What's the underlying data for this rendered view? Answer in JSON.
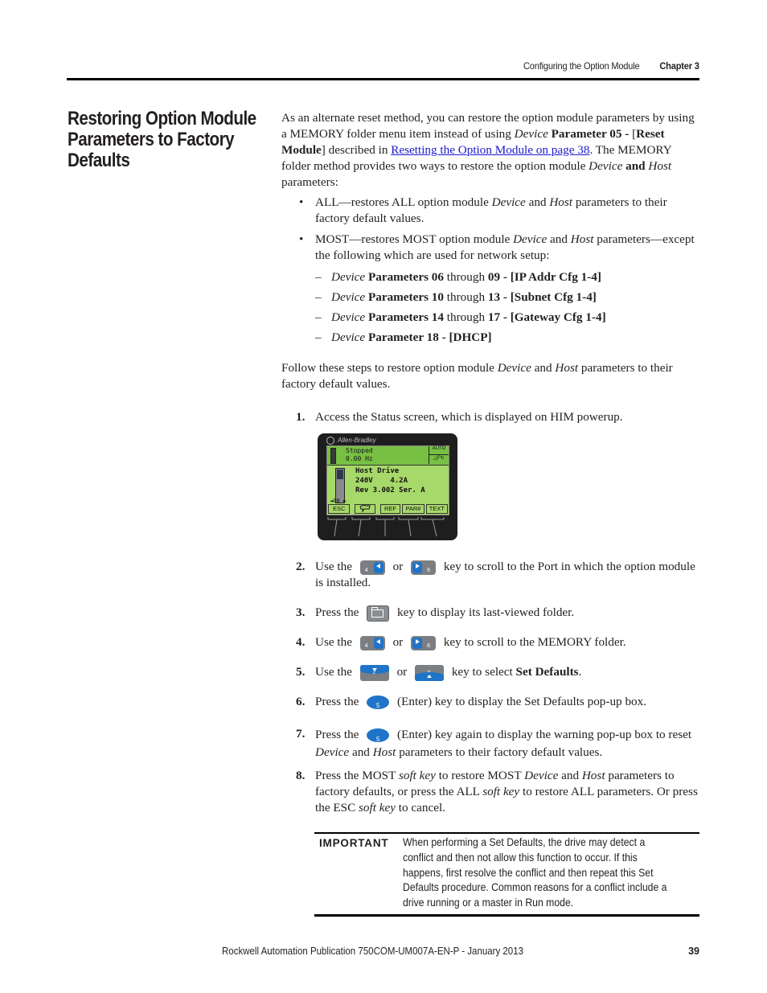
{
  "header": {
    "section": "Configuring the Option Module",
    "chapter": "Chapter 3"
  },
  "title": "Restoring Option Module Parameters to Factory Defaults",
  "intro": {
    "t1": "As an alternate reset method, you can restore the option module parameters by using a MEMORY folder menu item instead of using ",
    "device": "Device",
    "param05": "Parameter 05 -",
    "t2": "[",
    "reset_module": "Reset Module",
    "t3": "] described in ",
    "link": "Resetting the Option Module on page 38",
    "t4": ". The MEMORY folder method provides two ways to restore the option module ",
    "device2": "Device",
    "and": "and",
    "host": "Host",
    "t5": " parameters:"
  },
  "bullets": [
    {
      "pre": "ALL—restores ALL option module ",
      "device": "Device",
      "mid": " and ",
      "host": "Host",
      "post": " parameters to their factory default values."
    },
    {
      "pre": "MOST—restores MOST option module ",
      "device": "Device",
      "mid": " and ",
      "host": "Host",
      "post": " parameters—except the following which are used for network setup:"
    }
  ],
  "dash_items": [
    {
      "device": "Device",
      "b1": "Parameters 06",
      "mid": " through ",
      "b2": "09 -",
      "br": "[IP Addr Cfg 1-4]"
    },
    {
      "device": "Device",
      "b1": "Parameters 10",
      "mid": " through ",
      "b2": "13 -",
      "br": "[Subnet Cfg 1-4]"
    },
    {
      "device": "Device",
      "b1": "Parameters 14",
      "mid": " through ",
      "b2": "17 -",
      "br": "[Gateway Cfg 1-4]"
    },
    {
      "device": "Device",
      "b1": "Parameter 18 -",
      "mid": "",
      "b2": "",
      "br": "[DHCP]"
    }
  ],
  "follow": {
    "pre": "Follow these steps to restore option module ",
    "device": "Device",
    "mid": " and ",
    "host": "Host",
    "post": " parameters to their factory default values."
  },
  "steps": {
    "s1": {
      "num": "1.",
      "text": "Access the Status screen, which is displayed on HIM powerup."
    },
    "s2": {
      "num": "2.",
      "a": "Use the",
      "or": "or",
      "b": "key to scroll to the Port in which the option module is installed."
    },
    "s3": {
      "num": "3.",
      "a": "Press the",
      "b": "key to display its last-viewed folder."
    },
    "s4": {
      "num": "4.",
      "a": "Use the",
      "or": "or",
      "b": "key to scroll to the MEMORY folder."
    },
    "s5": {
      "num": "5.",
      "a": "Use the",
      "or": "or",
      "b": "key to select ",
      "bold": "Set Defaults",
      "end": "."
    },
    "s6": {
      "num": "6.",
      "a": "Press the",
      "b": "(Enter) key to display the Set Defaults pop-up box."
    },
    "s7": {
      "num": "7.",
      "a": "Press the",
      "b": "(Enter) key again to display the warning pop-up box to reset ",
      "device": "Device",
      "mid": " and ",
      "host": "Host",
      "c": " parameters to their factory default values."
    },
    "s8": {
      "num": "8.",
      "a": "Press the MOST ",
      "sk1": "soft key",
      "b": " to restore MOST ",
      "device": "Device",
      "mid": " and ",
      "host": "Host",
      "c": " parameters to factory defaults, or press the ALL ",
      "sk2": "soft key",
      "d": " to restore ALL parameters. Or press the ESC ",
      "sk3": "soft key",
      "e": " to cancel."
    }
  },
  "keys": {
    "left": "4",
    "right": "6",
    "down": "2",
    "up": "8",
    "enter": "5"
  },
  "him": {
    "brand": "Allen-Bradley",
    "status": "Stopped",
    "freq": "0.00 Hz",
    "mode": "AUTO",
    "flags": "F",
    "line1": "Host Drive",
    "line2": "240V    4.2A",
    "line3": "Rev 3.002 Ser. A",
    "port": "◄00 ►",
    "softkeys": [
      "ESC",
      "",
      "REF",
      "PAR#",
      "TEXT"
    ]
  },
  "important": {
    "label": "IMPORTANT",
    "text": "When performing a Set Defaults, the drive may detect a conflict and then not allow this function to occur. If this happens, first resolve the conflict and then repeat this Set Defaults procedure. Common reasons for a conflict include a drive running or a master in Run mode."
  },
  "footer": {
    "publication": "Rockwell Automation Publication 750COM-UM007A-EN-P - January 2013",
    "page": "39"
  }
}
